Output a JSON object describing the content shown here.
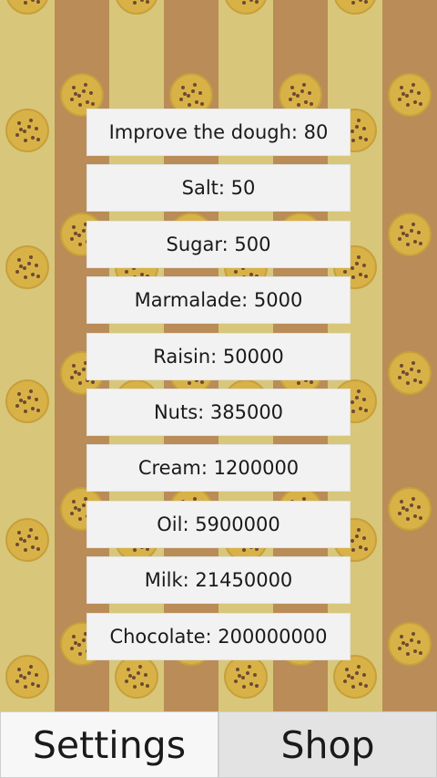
{
  "colors": {
    "stripe_light": "#d8c77a",
    "stripe_dark": "#b98c58",
    "cookie_fill": "#d8b246",
    "cookie_edge": "#c7a03c",
    "chip": "#6e4a33",
    "panel": "#f2f2f2"
  },
  "upgrades": [
    {
      "label": "Improve the dough: 80"
    },
    {
      "label": "Salt: 50"
    },
    {
      "label": "Sugar: 500"
    },
    {
      "label": "Marmalade: 5000"
    },
    {
      "label": "Raisin: 50000"
    },
    {
      "label": "Nuts: 385000"
    },
    {
      "label": "Cream: 1200000"
    },
    {
      "label": "Oil: 5900000"
    },
    {
      "label": "Milk: 21450000"
    },
    {
      "label": "Chocolate: 200000000"
    }
  ],
  "bottom_bar": {
    "settings_label": "Settings",
    "shop_label": "Shop"
  }
}
